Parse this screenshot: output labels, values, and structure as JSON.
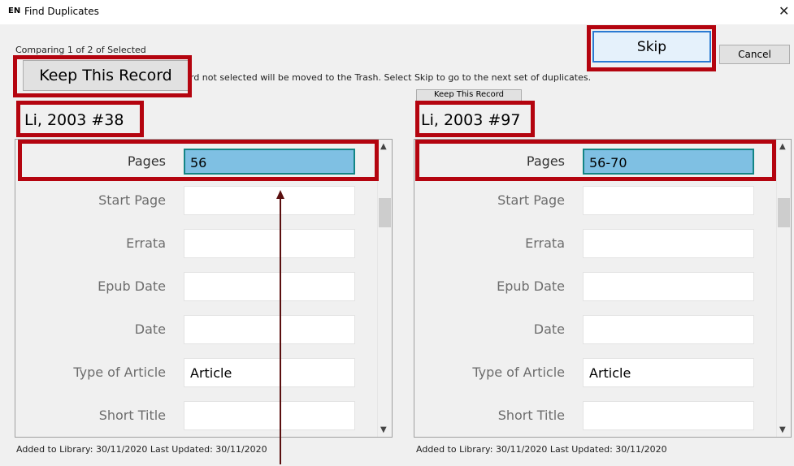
{
  "window": {
    "app_badge": "EN",
    "title": "Find Duplicates",
    "close_glyph": "✕"
  },
  "instructions": {
    "top_fragment": "Comparing 1 of 2 of Selected",
    "main": "rd not selected will be moved to the Trash. Select Skip to go to the next set of duplicates."
  },
  "buttons": {
    "keep_left": "Keep This Record",
    "keep_right_tab": "Keep This Record",
    "skip": "Skip",
    "cancel": "Cancel"
  },
  "left": {
    "record_title": "Li, 2003 #38",
    "fields": [
      {
        "label": "Pages",
        "value": "56"
      },
      {
        "label": "Start Page",
        "value": ""
      },
      {
        "label": "Errata",
        "value": ""
      },
      {
        "label": "Epub Date",
        "value": ""
      },
      {
        "label": "Date",
        "value": ""
      },
      {
        "label": "Type of Article",
        "value": "Article"
      },
      {
        "label": "Short Title",
        "value": ""
      }
    ],
    "footer": "Added to Library: 30/11/2020    Last Updated: 30/11/2020"
  },
  "right": {
    "record_title": "Li, 2003 #97",
    "fields": [
      {
        "label": "Pages",
        "value": "56-70"
      },
      {
        "label": "Start Page",
        "value": ""
      },
      {
        "label": "Errata",
        "value": ""
      },
      {
        "label": "Epub Date",
        "value": ""
      },
      {
        "label": "Date",
        "value": ""
      },
      {
        "label": "Type of Article",
        "value": "Article"
      },
      {
        "label": "Short Title",
        "value": ""
      }
    ],
    "footer": "Added to Library: 30/11/2020    Last Updated: 30/11/2020"
  },
  "icons": {
    "scroll_up": "▲",
    "scroll_down": "▼"
  },
  "colors": {
    "highlight_box": "#b4040f",
    "selected_field": "#7fc0e3",
    "arrow": "#5a0f0f"
  }
}
